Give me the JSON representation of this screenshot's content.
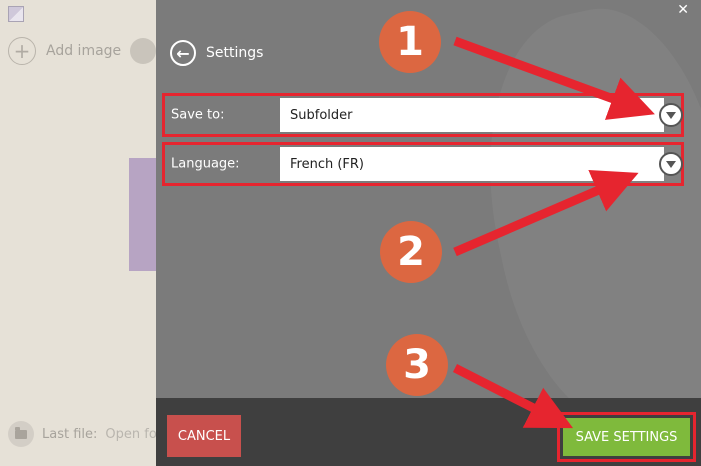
{
  "background": {
    "add_image_label": "Add image",
    "last_file_label": "Last file:",
    "open_file_label": "Open fo"
  },
  "settings": {
    "title": "Settings",
    "save_to": {
      "label": "Save to:",
      "value": "Subfolder"
    },
    "language": {
      "label": "Language:",
      "value": "French (FR)"
    },
    "cancel_label": "CANCEL",
    "save_label": "SAVE SETTINGS"
  },
  "annotations": {
    "badge_1": "1",
    "badge_2": "2",
    "badge_3": "3",
    "badge_color": "#dc6741",
    "highlight_color": "#e6252f",
    "arrow_color": "#e6252f"
  },
  "colors": {
    "panel_bg": "#7b7b7b",
    "footer_bg": "#3f3f3f",
    "cancel_bg": "#c8504d",
    "save_bg": "#7fba3c"
  }
}
